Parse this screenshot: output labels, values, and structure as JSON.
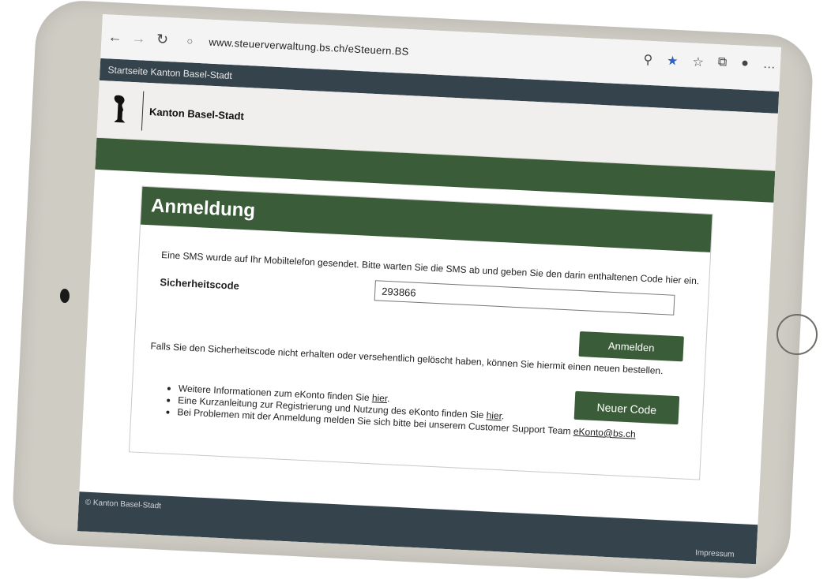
{
  "browser": {
    "url": "www.steuerverwaltung.bs.ch/eSteuern.BS"
  },
  "site": {
    "topbar_link": "Startseite Kanton Basel-Stadt",
    "canton_name": "Kanton Basel-Stadt"
  },
  "login": {
    "title": "Anmeldung",
    "sms_message": "Eine SMS wurde auf Ihr Mobiltelefon gesendet. Bitte warten Sie die SMS ab und geben Sie den darin enthaltenen Code hier ein.",
    "code_label": "Sicherheitscode",
    "code_value": "293866",
    "login_button": "Anmelden",
    "resend_info": "Falls Sie den Sicherheitscode nicht erhalten oder versehentlich gelöscht haben, können Sie hiermit einen neuen bestellen.",
    "new_code_button": "Neuer Code",
    "links": [
      {
        "text": "Weitere Informationen zum eKonto finden Sie ",
        "link": "hier",
        "suffix": "."
      },
      {
        "text": "Eine Kurzanleitung zur Registrierung und Nutzung des eKonto finden Sie ",
        "link": "hier",
        "suffix": "."
      },
      {
        "text": "Bei Problemen mit der Anmeldung melden Sie sich bitte bei unserem Customer Support Team ",
        "link": "eKonto@bs.ch",
        "suffix": ""
      }
    ]
  },
  "footer": {
    "copyright": "© Kanton Basel-Stadt",
    "impressum": "Impressum"
  }
}
